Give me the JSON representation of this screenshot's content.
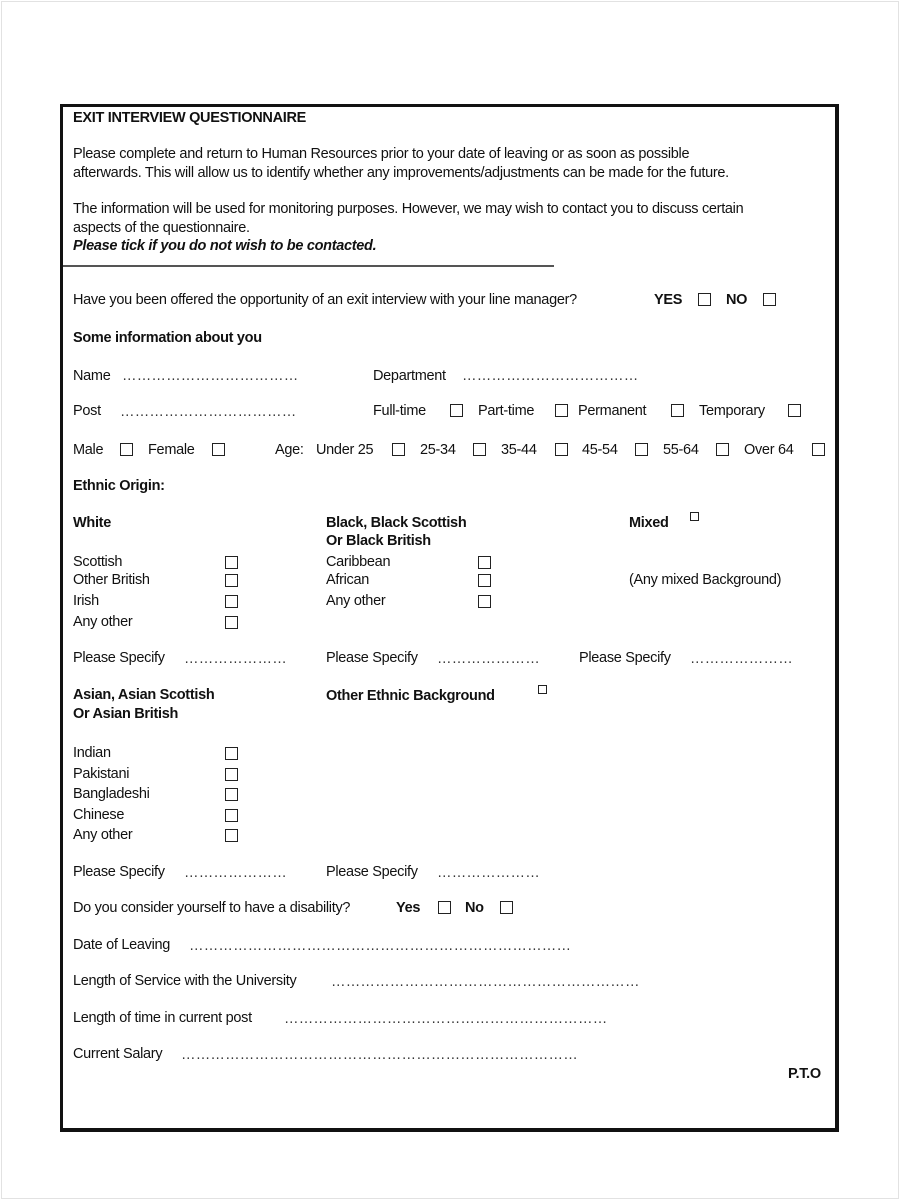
{
  "header": {
    "title": "EXIT INTERVIEW QUESTIONNAIRE",
    "intro_line1": "Please complete and return to Human Resources prior to your date of leaving or as soon as possible",
    "intro_line2": "afterwards.  This will allow us to identify whether any improvements/adjustments can be made for the future.",
    "info_line1": "The information will be used for monitoring purposes.  However, we may wish to contact you to discuss certain",
    "info_line2": "aspects of the questionnaire.",
    "no_contact_note": "Please tick if you do not wish to be contacted."
  },
  "exit_interview": {
    "question": "Have you been offered the opportunity of an exit interview with your line manager?",
    "yes_label": "YES",
    "no_label": "NO"
  },
  "about_you": {
    "heading": "Some information about you",
    "name_label": "Name",
    "name_dots": "………………………………",
    "department_label": "Department",
    "department_dots": "………………………………",
    "post_label": "Post",
    "post_dots": "………………………………",
    "employment_types": [
      "Full-time",
      "Part-time",
      "Permanent",
      "Temporary"
    ],
    "gender_options": [
      "Male",
      "Female"
    ],
    "age_label": "Age:",
    "age_options": [
      "Under 25",
      "25-34",
      "35-44",
      "45-54",
      "55-64",
      "Over 64"
    ]
  },
  "ethnic_origin": {
    "heading": "Ethnic Origin:",
    "white": {
      "heading": "White",
      "options": [
        "Scottish",
        "Other British",
        "Irish",
        "Any other"
      ],
      "specify_label": "Please Specify",
      "specify_dots": "…………………"
    },
    "black": {
      "heading_line1": "Black, Black Scottish",
      "heading_line2": "Or Black British",
      "options": [
        "Caribbean",
        "African",
        "Any other"
      ],
      "specify_label": "Please Specify",
      "specify_dots": "…………………"
    },
    "mixed": {
      "heading": "Mixed",
      "note": "(Any mixed Background)",
      "specify_label": "Please Specify",
      "specify_dots": "…………………"
    },
    "asian": {
      "heading_line1": "Asian, Asian Scottish",
      "heading_line2": "Or Asian British",
      "options": [
        "Indian",
        "Pakistani",
        "Bangladeshi",
        "Chinese",
        "Any other"
      ],
      "specify_label": "Please Specify",
      "specify_dots": "…………………"
    },
    "other": {
      "heading": "Other Ethnic Background",
      "specify_label": "Please Specify",
      "specify_dots": "…………………"
    }
  },
  "disability": {
    "question": "Do you consider yourself to have a disability?",
    "yes_label": "Yes",
    "no_label": "No"
  },
  "employment_details": {
    "date_of_leaving_label": "Date of Leaving",
    "date_of_leaving_dots": "……………………………………………………………………",
    "length_of_service_label": "Length of Service with the University",
    "length_of_service_dots": "………………………………………………………",
    "time_in_post_label": "Length of time in current post",
    "time_in_post_dots": "…………………………………………………………",
    "salary_label": "Current Salary",
    "salary_dots": "………………………………………………………………………"
  },
  "footer": {
    "pto": "P.T.O"
  }
}
